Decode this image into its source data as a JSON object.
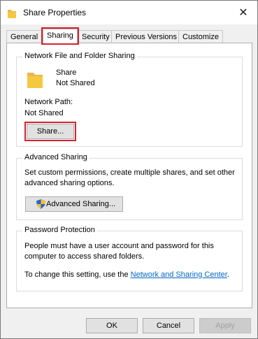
{
  "window": {
    "title": "Share Properties",
    "close_glyph": "✕"
  },
  "tabs": [
    {
      "label": "General"
    },
    {
      "label": "Sharing",
      "active": true
    },
    {
      "label": "Security"
    },
    {
      "label": "Previous Versions"
    },
    {
      "label": "Customize"
    }
  ],
  "network_sharing": {
    "group_title": "Network File and Folder Sharing",
    "folder_name": "Share",
    "folder_status": "Not Shared",
    "path_label": "Network Path:",
    "path_value": "Not Shared",
    "share_button": "Share..."
  },
  "advanced_sharing": {
    "group_title": "Advanced Sharing",
    "description": [
      "Set custom permissions, create multiple shares, and set other",
      "advanced sharing options."
    ],
    "button": "Advanced Sharing...",
    "button_icon": "uac-shield-icon"
  },
  "password_protection": {
    "group_title": "Password Protection",
    "description": [
      "People must have a user account and password for this",
      "computer to access shared folders."
    ],
    "setting_prefix": "To change this setting, use the ",
    "link_text": "Network and Sharing Center",
    "setting_suffix": "."
  },
  "footer": {
    "ok": "OK",
    "cancel": "Cancel",
    "apply": "Apply"
  },
  "colors": {
    "highlight": "#d6232f",
    "link": "#0066cc",
    "folder": "#f5c842"
  }
}
